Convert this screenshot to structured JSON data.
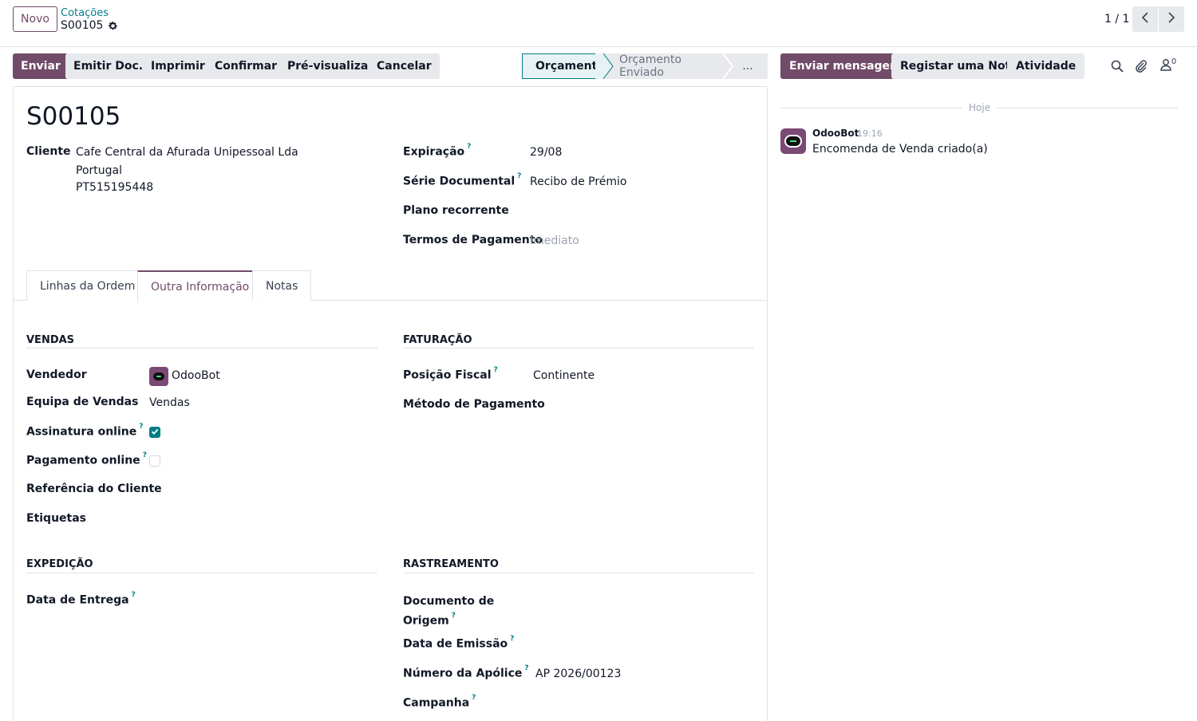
{
  "topbar": {
    "new_label": "Novo",
    "breadcrumb_parent": "Cotações",
    "breadcrumb_current": "S00105",
    "pager": "1 / 1"
  },
  "actions": {
    "send": "Enviar",
    "emit_doc": "Emitir Doc.",
    "print": "Imprimir",
    "confirm": "Confirmar",
    "preview": "Pré-visualizar",
    "cancel": "Cancelar"
  },
  "status": {
    "active": "Orçamento",
    "next": "Orçamento Enviado",
    "more": "..."
  },
  "chatter": {
    "send_message": "Enviar mensagem",
    "log_note": "Registar uma Nota",
    "activity": "Atividade",
    "followers_count": "0",
    "today_label": "Hoje",
    "message": {
      "author": "OdooBot",
      "time": "19:16",
      "body": "Encomenda de Venda criado(a)"
    }
  },
  "form": {
    "title": "S00105",
    "customer_label": "Cliente",
    "customer_name": "Cafe Central da Afurada Unipessoal Lda",
    "customer_country": "Portugal",
    "customer_vat": "PT515195448",
    "expiration_label": "Expiração",
    "expiration_value": "29/08",
    "doc_series_label": "Série Documental",
    "doc_series_value": "Recibo de Prémio",
    "recurring_label": "Plano recorrente",
    "payment_terms_label": "Termos de Pagamento",
    "payment_terms_value": "Imediato",
    "help_mark": "?"
  },
  "tabs": [
    "Linhas da Ordem",
    "Outra Informação",
    "Notas"
  ],
  "sales": {
    "title": "VENDAS",
    "salesperson_label": "Vendedor",
    "salesperson_value": "OdooBot",
    "team_label": "Equipa de Vendas",
    "team_value": "Vendas",
    "online_sign_label": "Assinatura online",
    "online_sign_checked": true,
    "online_pay_label": "Pagamento online",
    "online_pay_checked": false,
    "client_ref_label": "Referência do Cliente",
    "tags_label": "Etiquetas"
  },
  "invoicing": {
    "title": "FATURAÇÃO",
    "fiscal_position_label": "Posição Fiscal",
    "fiscal_position_value": "Continente",
    "payment_method_label": "Método de Pagamento"
  },
  "shipping": {
    "title": "EXPEDIÇÃO",
    "delivery_date_label": "Data de Entrega"
  },
  "tracking": {
    "title": "RASTREAMENTO",
    "source_doc_label_1": "Documento de",
    "source_doc_label_2": "Origem",
    "issue_date_label": "Data de Emissão",
    "policy_number_label": "Número da Apólice",
    "policy_number_value": "AP 2026/00123",
    "campaign_label": "Campanha"
  },
  "colors": {
    "brand": "#714b67",
    "accent": "#017e84"
  }
}
